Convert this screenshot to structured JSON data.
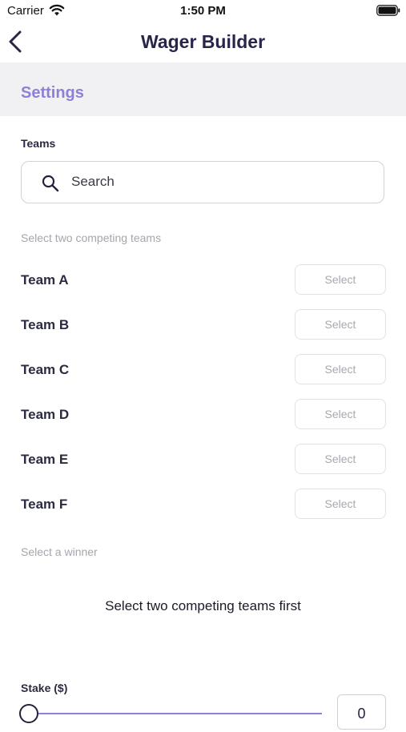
{
  "status_bar": {
    "carrier": "Carrier",
    "time": "1:50 PM",
    "icons": [
      "wifi-icon",
      "battery-icon"
    ]
  },
  "nav": {
    "title": "Wager Builder",
    "back_icon": "chevron-left-icon"
  },
  "settings": {
    "title": "Settings"
  },
  "teams": {
    "label": "Teams",
    "search_placeholder": "Search",
    "search_value": "",
    "search_icon": "magnifier-icon",
    "hint": "Select two competing teams",
    "items": [
      {
        "name": "Team A",
        "button": "Select"
      },
      {
        "name": "Team B",
        "button": "Select"
      },
      {
        "name": "Team C",
        "button": "Select"
      },
      {
        "name": "Team D",
        "button": "Select"
      },
      {
        "name": "Team E",
        "button": "Select"
      },
      {
        "name": "Team F",
        "button": "Select"
      }
    ]
  },
  "winner": {
    "hint": "Select a winner",
    "empty_message": "Select two competing teams first"
  },
  "stake": {
    "label": "Stake ($)",
    "value": "0",
    "slider_fraction": 0
  },
  "colors": {
    "accent": "#8f7fd6",
    "title": "#27264a",
    "section_bg": "#f1f1f3"
  }
}
